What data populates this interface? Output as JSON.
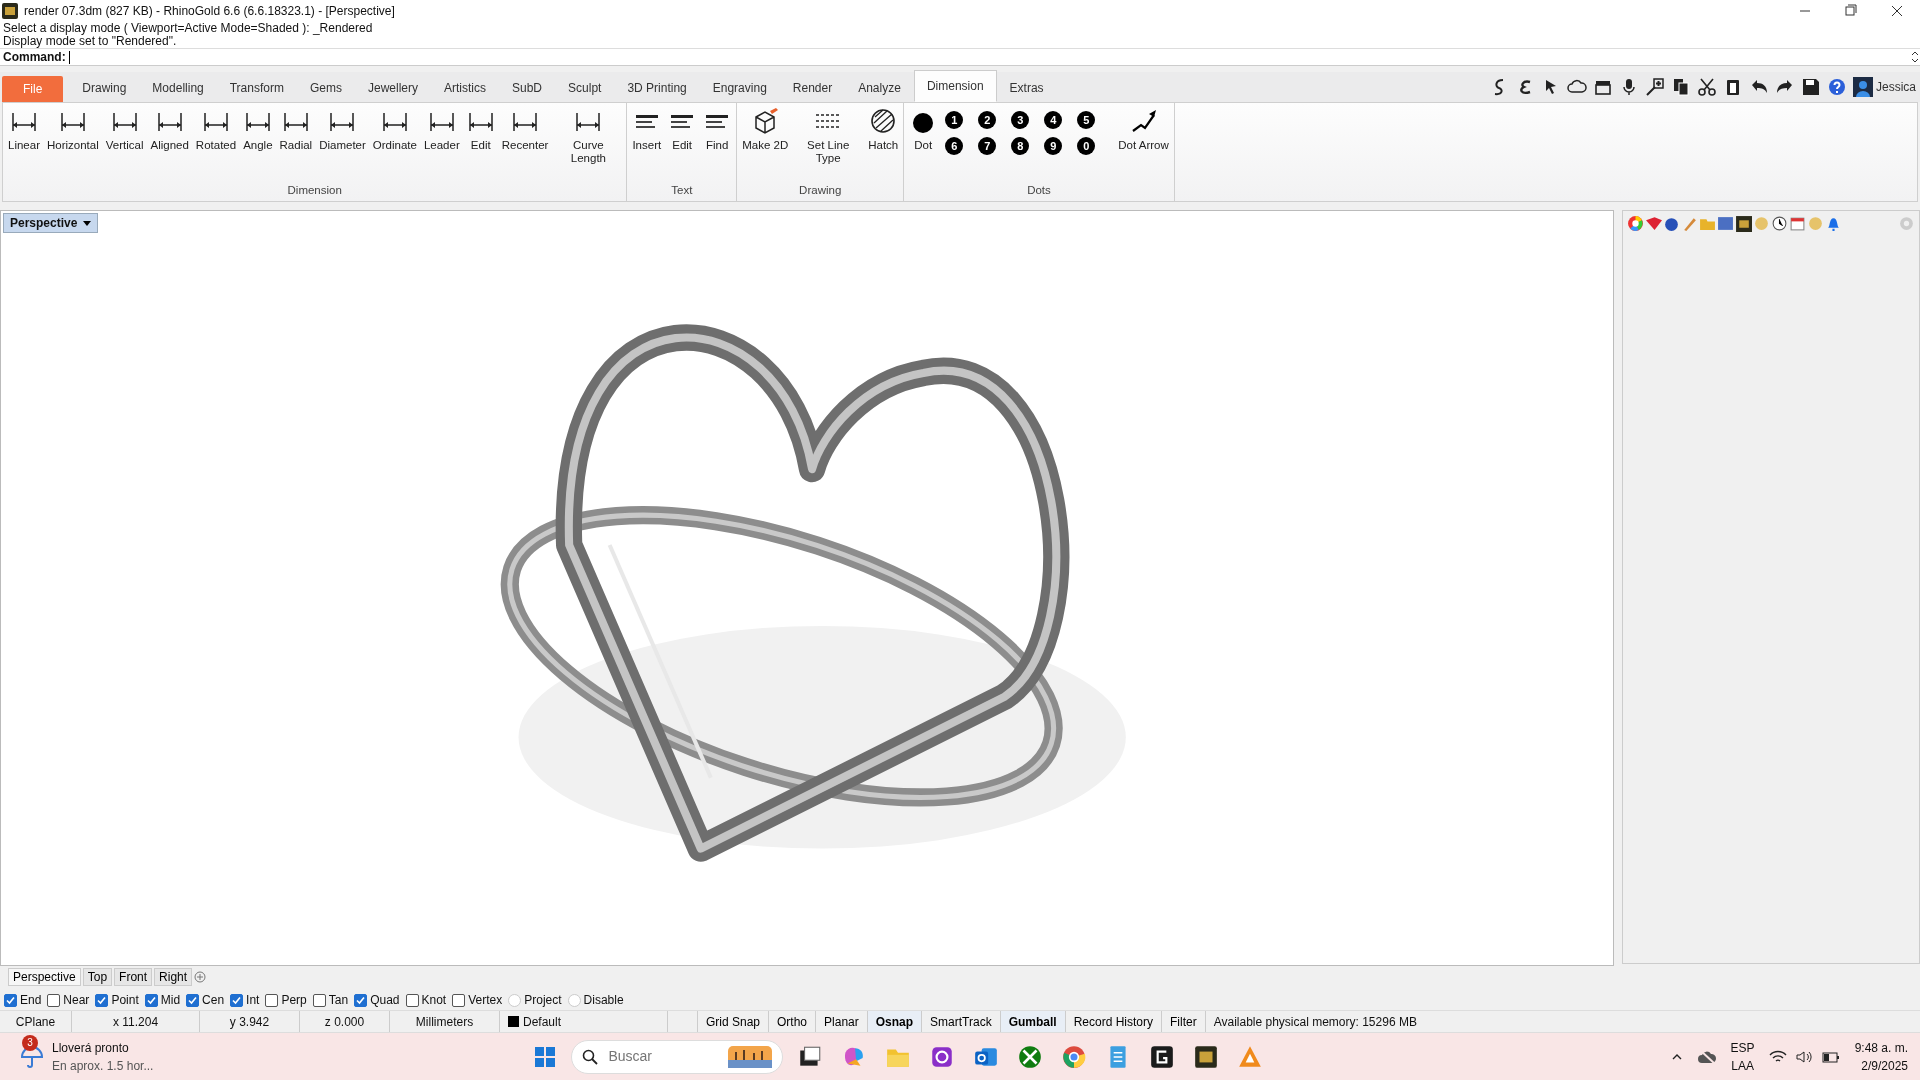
{
  "window": {
    "title": "render 07.3dm (827 KB) - RhinoGold 6.6 (6.6.18323.1) - [Perspective]"
  },
  "command_history": [
    "Select a display mode ( Viewport=Active Mode=Shaded ): _Rendered",
    "Display mode set to \"Rendered\"."
  ],
  "command": {
    "label": "Command:"
  },
  "ribbon_tabs": [
    {
      "label": "File",
      "kind": "file",
      "selected": false
    },
    {
      "label": "Drawing",
      "kind": "tab",
      "selected": false
    },
    {
      "label": "Modelling",
      "kind": "tab",
      "selected": false
    },
    {
      "label": "Transform",
      "kind": "tab",
      "selected": false
    },
    {
      "label": "Gems",
      "kind": "tab",
      "selected": false
    },
    {
      "label": "Jewellery",
      "kind": "tab",
      "selected": false
    },
    {
      "label": "Artistics",
      "kind": "tab",
      "selected": false
    },
    {
      "label": "SubD",
      "kind": "tab",
      "selected": false
    },
    {
      "label": "Sculpt",
      "kind": "tab",
      "selected": false
    },
    {
      "label": "3D Printing",
      "kind": "tab",
      "selected": false
    },
    {
      "label": "Engraving",
      "kind": "tab",
      "selected": false
    },
    {
      "label": "Render",
      "kind": "tab",
      "selected": false
    },
    {
      "label": "Analyze",
      "kind": "tab",
      "selected": false
    },
    {
      "label": "Dimension",
      "kind": "tab",
      "selected": true
    },
    {
      "label": "Extras",
      "kind": "tab",
      "selected": false
    }
  ],
  "user": {
    "name": "Jessica"
  },
  "ribbon_groups": [
    {
      "title": "Dimension",
      "tools": [
        "Linear",
        "Horizontal",
        "Vertical",
        "Aligned",
        "Rotated",
        "Angle",
        "Radial",
        "Diameter",
        "Ordinate",
        "Leader",
        "Edit",
        "Recenter",
        "Curve Length"
      ]
    },
    {
      "title": "Text",
      "tools": [
        "Insert",
        "Edit",
        "Find"
      ]
    },
    {
      "title": "Drawing",
      "tools": [
        "Make 2D",
        "Set Line Type",
        "Hatch"
      ]
    },
    {
      "title": "Dots",
      "tools": [
        "Dot",
        "Dot Arrow"
      ],
      "numbered_dots": [
        "1",
        "2",
        "3",
        "4",
        "5",
        "6",
        "7",
        "8",
        "9",
        "0"
      ]
    }
  ],
  "viewport": {
    "label": "Perspective"
  },
  "view_tabs": [
    {
      "label": "Perspective",
      "selected": true
    },
    {
      "label": "Top",
      "selected": false
    },
    {
      "label": "Front",
      "selected": false
    },
    {
      "label": "Right",
      "selected": false
    }
  ],
  "osnaps": [
    {
      "label": "End",
      "kind": "check",
      "checked": true
    },
    {
      "label": "Near",
      "kind": "check",
      "checked": false
    },
    {
      "label": "Point",
      "kind": "check",
      "checked": true
    },
    {
      "label": "Mid",
      "kind": "check",
      "checked": true
    },
    {
      "label": "Cen",
      "kind": "check",
      "checked": true
    },
    {
      "label": "Int",
      "kind": "check",
      "checked": true
    },
    {
      "label": "Perp",
      "kind": "check",
      "checked": false
    },
    {
      "label": "Tan",
      "kind": "check",
      "checked": false
    },
    {
      "label": "Quad",
      "kind": "check",
      "checked": true
    },
    {
      "label": "Knot",
      "kind": "check",
      "checked": false
    },
    {
      "label": "Vertex",
      "kind": "check",
      "checked": false
    },
    {
      "label": "Project",
      "kind": "radio",
      "checked": false
    },
    {
      "label": "Disable",
      "kind": "radio",
      "checked": false
    }
  ],
  "status_bar": {
    "cells": [
      {
        "label": "CPlane",
        "kind": "text"
      },
      {
        "label": "x 11.204",
        "kind": "text"
      },
      {
        "label": "y 3.942",
        "kind": "text"
      },
      {
        "label": "z 0.000",
        "kind": "text"
      },
      {
        "label": "Millimeters",
        "kind": "text"
      },
      {
        "label": "Default",
        "kind": "layer"
      }
    ],
    "toggles": [
      {
        "label": "Grid Snap",
        "on": false
      },
      {
        "label": "Ortho",
        "on": false
      },
      {
        "label": "Planar",
        "on": false
      },
      {
        "label": "Osnap",
        "on": true
      },
      {
        "label": "SmartTrack",
        "on": false
      },
      {
        "label": "Gumball",
        "on": true
      },
      {
        "label": "Record History",
        "on": false
      },
      {
        "label": "Filter",
        "on": false
      }
    ],
    "memory": "Available physical memory: 15296 MB"
  },
  "taskbar": {
    "weather": {
      "badge": "3",
      "title": "Lloverá pronto",
      "subtitle": "En aprox. 1.5 hor..."
    },
    "search": {
      "placeholder": "Buscar"
    },
    "language": "ESP",
    "region": "LAA",
    "time": "9:48 a. m.",
    "date": "2/9/2025"
  }
}
